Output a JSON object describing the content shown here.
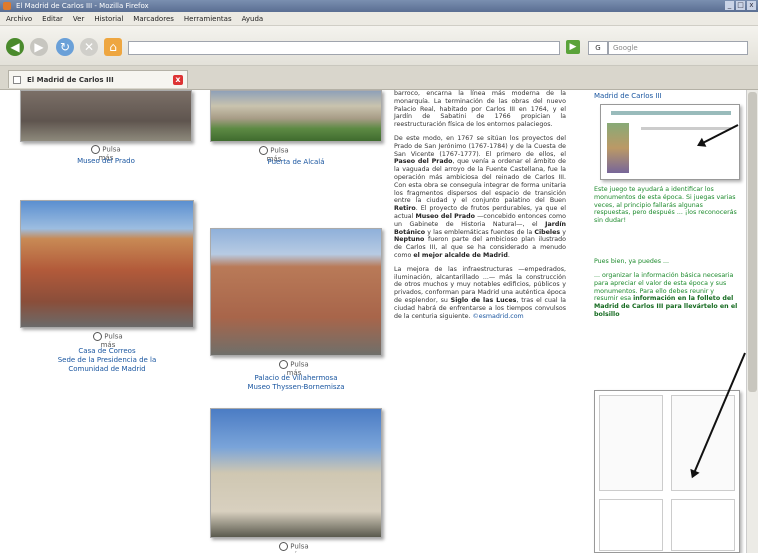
{
  "window": {
    "title": "El Madrid de Carlos III - Mozilla Firefox"
  },
  "menu": [
    "Archivo",
    "Editar",
    "Ver",
    "Historial",
    "Marcadores",
    "Herramientas",
    "Ayuda"
  ],
  "search": {
    "engine_label": "G",
    "placeholder": "Google"
  },
  "tab": {
    "label": "El Madrid de Carlos III",
    "close": "x"
  },
  "photos": {
    "zoom_label": "Pulsa más",
    "prado": "Museo del Prado",
    "alcala": "Puerta de Alcalá",
    "correos_1": "Casa de Correos",
    "correos_2": "Sede de la Presidencia de la",
    "correos_3": "Comunidad de Madrid",
    "villa_1": "Palacio de Villahermosa",
    "villa_2": "Museo Thyssen-Bornemisza"
  },
  "article": {
    "p1": "barroco, encarna la línea más moderna de la monarquía. La terminación de las obras del nuevo Palacio Real, habitado por Carlos III en 1764, y el Jardín de Sabatini de 1766 propician la reestructuración física de los entornos palaciegos.",
    "p2a": "De este modo, en 1767 se sitúan los proyectos del Prado de San Jerónimo (1767-1784) y de la Cuesta de San Vicente (1767-1777). El primero de ellos, el ",
    "p2b": "Paseo del Prado",
    "p2c": ", que venía a ordenar el ámbito de la vaguada del arroyo de la Fuente Castellana, fue la operación más ambiciosa del reinado de Carlos III. Con esta obra se conseguía integrar de forma unitaria los fragmentos dispersos del espacio de transición entre la ciudad y el conjunto palatino del Buen ",
    "p2d": "Retiro",
    "p2e": ". El proyecto de frutos perdurables, ya que el actual ",
    "p2f": "Museo del Prado",
    "p2g": " —concebido entonces como un Gabinete de Historia Natural—, el ",
    "p2h": "Jardín Botánico",
    "p2i": " y las emblemáticas fuentes de la ",
    "p2j": "Cibeles",
    "p2k": " y ",
    "p2l": "Neptuno",
    "p2m": " fueron parte del ambicioso plan ilustrado de Carlos III, al que se ha considerado a menudo como ",
    "p2n": "el mejor alcalde de Madrid",
    "p3a": "La mejora de las infraestructuras —empedrados, iluminación, alcantarillado ...— más la construcción de otros muchos y muy notables edificios, públicos y privados, conforman para Madrid una auténtica época de esplendor, su ",
    "p3b": "Siglo de las Luces",
    "p3c": ", tras el cual la ciudad habrá de enfrentarse a los tiempos convulsos de la centuria siguiente. ",
    "p3d": "©esmadrid.com"
  },
  "sidebar": {
    "link": "Madrid de Carlos III",
    "g1": "Este juego te ayudará a identificar los monumentos de esta época. Si juegas varias veces, al principio fallarás algunas respuestas, pero después ... ¡los reconocerás sin dudar!",
    "g2": "Pues bien, ya puedes ...",
    "g3a": "... organizar la información básica necesaria para apreciar el valor de esta época y sus monumentos. Para ello debes reunir y resumir esa ",
    "g3b": "información en la folleto del Madrid de Carlos III para llevártelo en el bolsillo"
  }
}
